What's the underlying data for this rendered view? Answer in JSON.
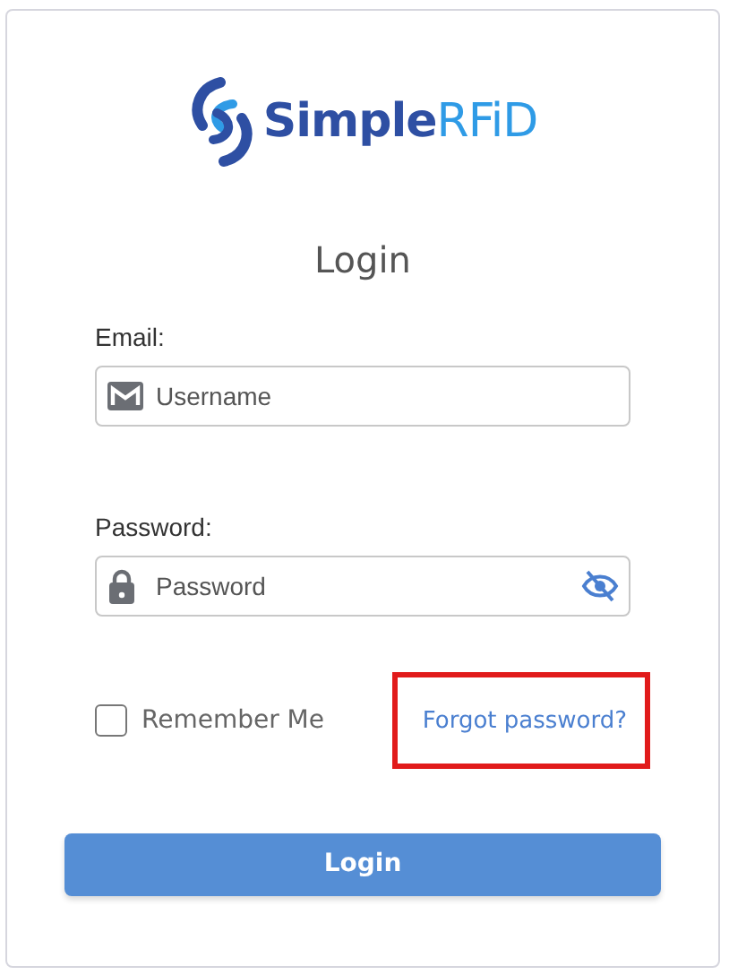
{
  "brand": {
    "prefix": "Simple",
    "suffix": "RFiD"
  },
  "title": "Login",
  "fields": [
    {
      "label": "Email:",
      "placeholder": "Username",
      "kind": "email"
    },
    {
      "label": "Password:",
      "placeholder": "Password",
      "kind": "password"
    }
  ],
  "remember": {
    "label": "Remember Me",
    "checked": false
  },
  "forgot": {
    "label": "Forgot password?",
    "highlighted": true
  },
  "submit": "Login"
}
